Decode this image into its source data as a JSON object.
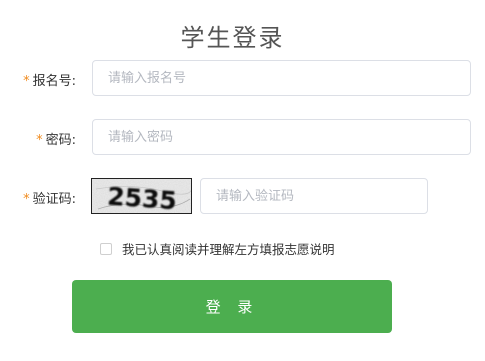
{
  "page": {
    "title": "学生登录"
  },
  "form": {
    "required_mark": "*",
    "exam_no": {
      "label": "报名号:",
      "value": "",
      "placeholder": "请输入报名号"
    },
    "password": {
      "label": "密码:",
      "value": "",
      "placeholder": "请输入密码"
    },
    "captcha": {
      "label": "验证码:",
      "image_text": "2535",
      "value": "",
      "placeholder": "请输入验证码"
    },
    "agreement": {
      "checked": false,
      "label": "我已认真阅读并理解左方填报志愿说明"
    },
    "submit_label": "登 录"
  },
  "colors": {
    "accent": "#4cae4f",
    "required": "#f08a1c",
    "border": "#dcdfe6",
    "placeholder": "#b4b8c0"
  }
}
